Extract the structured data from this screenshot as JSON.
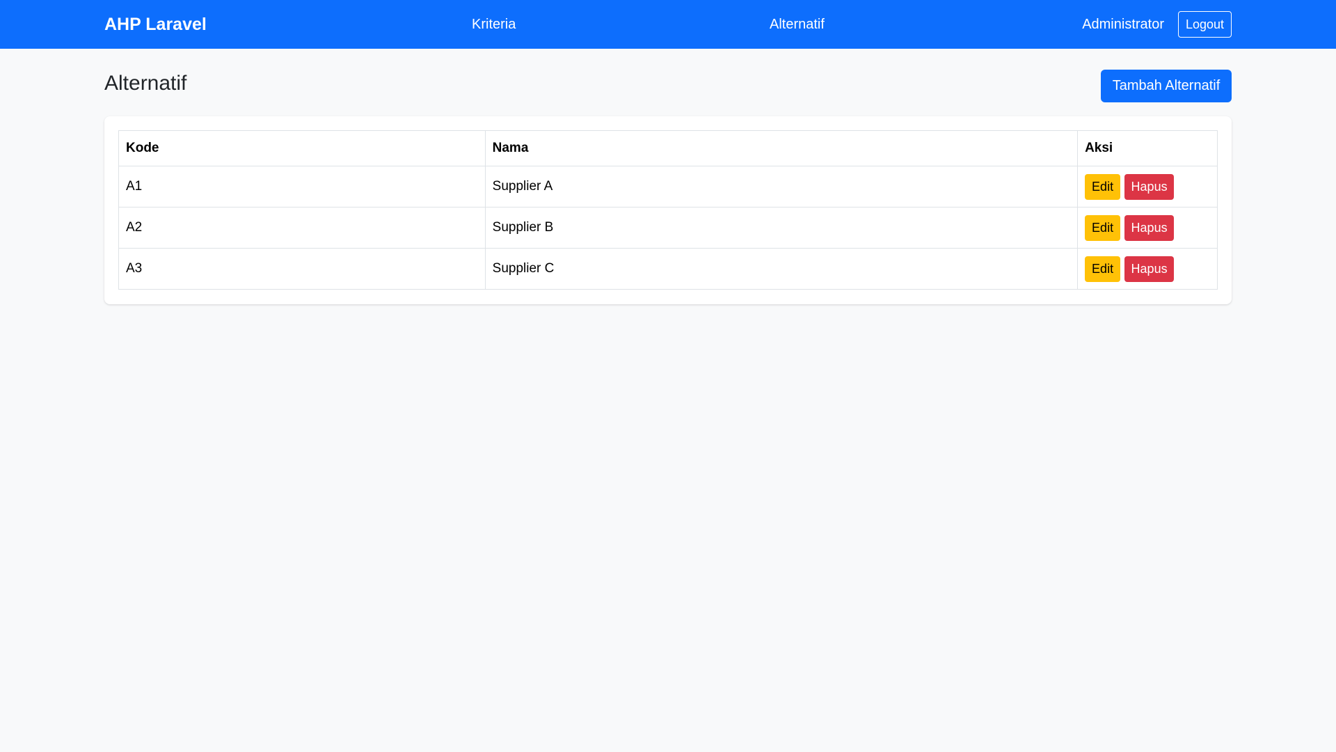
{
  "navbar": {
    "brand": "AHP Laravel",
    "links": [
      {
        "label": "Kriteria"
      },
      {
        "label": "Alternatif"
      }
    ],
    "user_name": "Administrator",
    "logout_label": "Logout"
  },
  "page": {
    "title": "Alternatif",
    "add_button_label": "Tambah Alternatif"
  },
  "table": {
    "headers": [
      "Kode",
      "Nama",
      "Aksi"
    ],
    "rows": [
      {
        "kode": "A1",
        "nama": "Supplier A"
      },
      {
        "kode": "A2",
        "nama": "Supplier B"
      },
      {
        "kode": "A3",
        "nama": "Supplier C"
      }
    ],
    "edit_label": "Edit",
    "delete_label": "Hapus"
  },
  "colors": {
    "primary": "#0d6efd",
    "warning": "#ffc107",
    "danger": "#dc3545",
    "background": "#f8f9fa"
  }
}
